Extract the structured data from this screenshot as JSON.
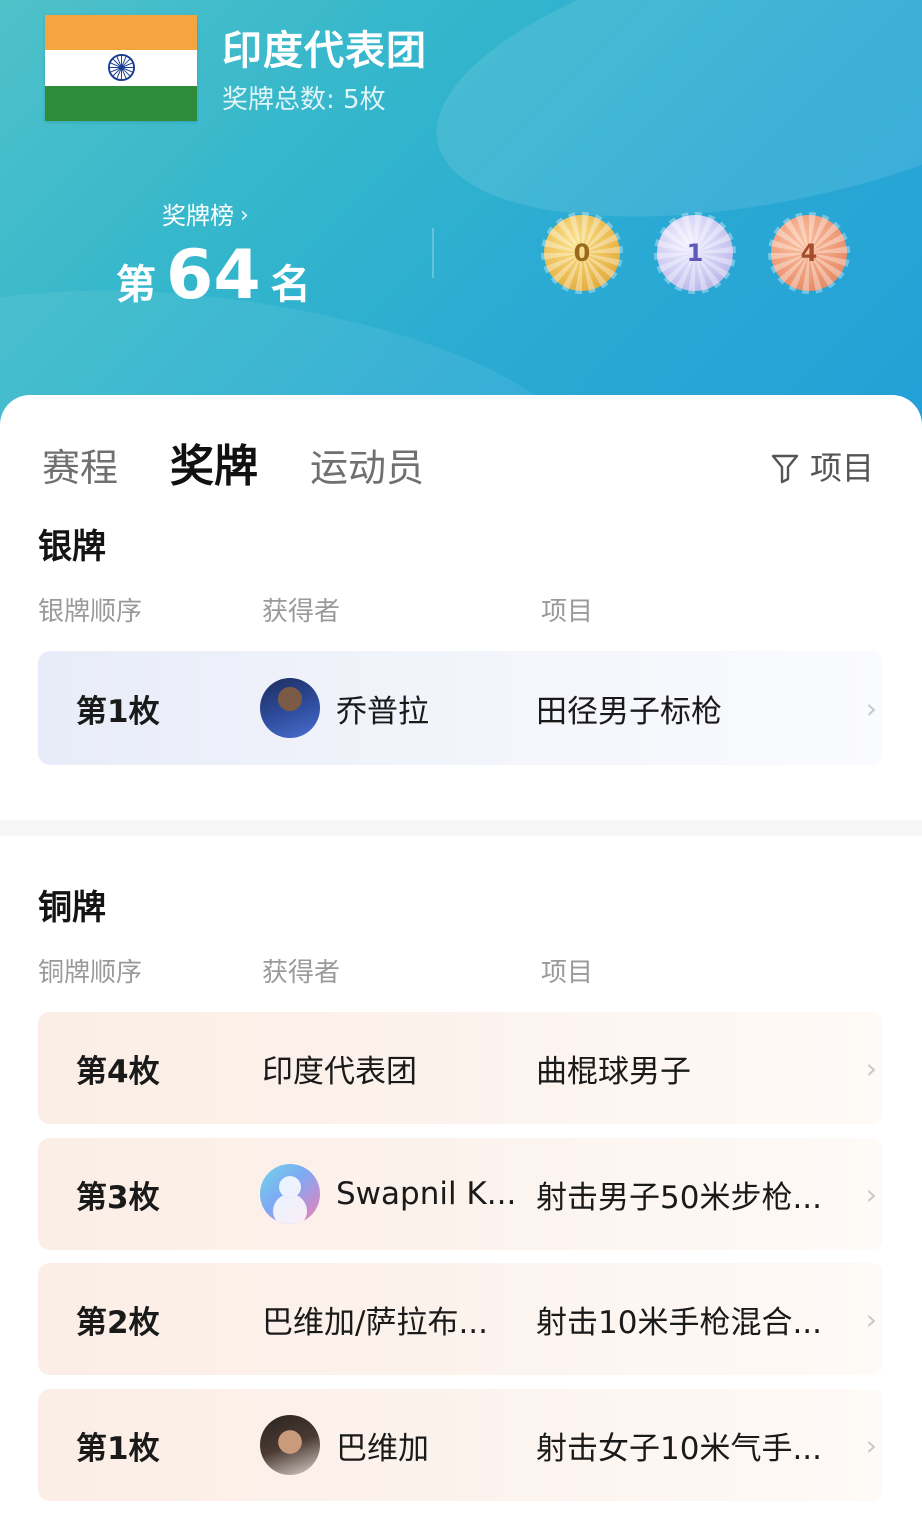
{
  "header": {
    "team_name": "印度代表团",
    "medal_total": "奖牌总数: 5枚",
    "rank_link": "奖牌榜",
    "rank_prefix": "第",
    "rank_number": "64",
    "rank_suffix": "名",
    "medals": {
      "gold": "0",
      "silver": "1",
      "bronze": "4"
    }
  },
  "tabs": {
    "schedule": "赛程",
    "medals": "奖牌",
    "athletes": "运动员",
    "filter": "项目"
  },
  "silver": {
    "title": "银牌",
    "col_order": "银牌顺序",
    "col_winner": "获得者",
    "col_event": "项目",
    "rows": [
      {
        "order": "第1枚",
        "winner": "乔普拉",
        "event": "田径男子标枪"
      }
    ]
  },
  "bronze": {
    "title": "铜牌",
    "col_order": "铜牌顺序",
    "col_winner": "获得者",
    "col_event": "项目",
    "rows": [
      {
        "order": "第4枚",
        "winner": "印度代表团",
        "event": "曲棍球男子"
      },
      {
        "order": "第3枚",
        "winner": "Swapnil K...",
        "event": "射击男子50米步枪..."
      },
      {
        "order": "第2枚",
        "winner": "巴维加/萨拉布...",
        "event": "射击10米手枪混合..."
      },
      {
        "order": "第1枚",
        "winner": "巴维加",
        "event": "射击女子10米气手..."
      }
    ]
  },
  "colors": {
    "header_start": "#4fc1c9",
    "header_end": "#23a0d6",
    "silver_row": "#e8ecf8",
    "bronze_row": "#fbeee6"
  },
  "icons": [
    "india-flag-icon",
    "chevron-right-icon",
    "gold-medal-icon",
    "silver-medal-icon",
    "bronze-medal-icon",
    "filter-icon",
    "avatar"
  ]
}
